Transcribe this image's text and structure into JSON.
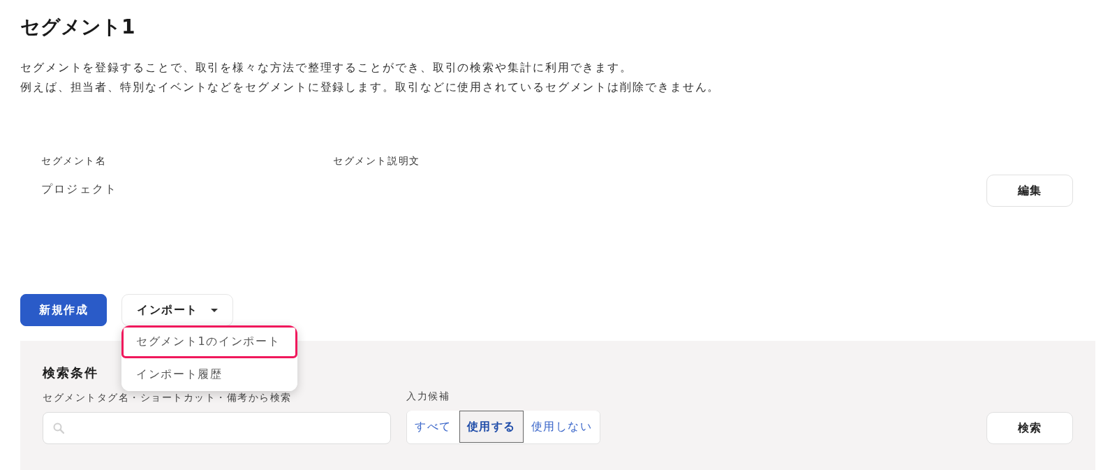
{
  "page": {
    "title": "セグメント1",
    "description": [
      "セグメントを登録することで、取引を様々な方法で整理することができ、取引の検索や集計に利用できます。",
      "例えば、担当者、特別なイベントなどをセグメントに登録します。取引などに使用されているセグメントは削除できません。"
    ]
  },
  "segment_info": {
    "columns": [
      {
        "label": "セグメント名",
        "value": "プロジェクト"
      },
      {
        "label": "セグメント説明文"
      }
    ],
    "edit_button": "編集"
  },
  "toolbar": {
    "new_button": "新規作成",
    "import_button": "インポート",
    "import_menu": {
      "expanded": true,
      "items": [
        {
          "label": "セグメント1のインポート",
          "selected": true
        },
        {
          "label": "インポート履歴",
          "selected": false
        }
      ]
    }
  },
  "search_panel": {
    "title": "検索条件",
    "keyword": {
      "label": "セグメントタグ名・ショートカット・備考から検索"
    },
    "suggestion": {
      "label": "入力候補",
      "options": [
        {
          "label": "すべて",
          "selected": false
        },
        {
          "label": "使用する",
          "selected": true
        },
        {
          "label": "使用しない",
          "selected": false
        }
      ]
    },
    "search_button": "検索"
  }
}
